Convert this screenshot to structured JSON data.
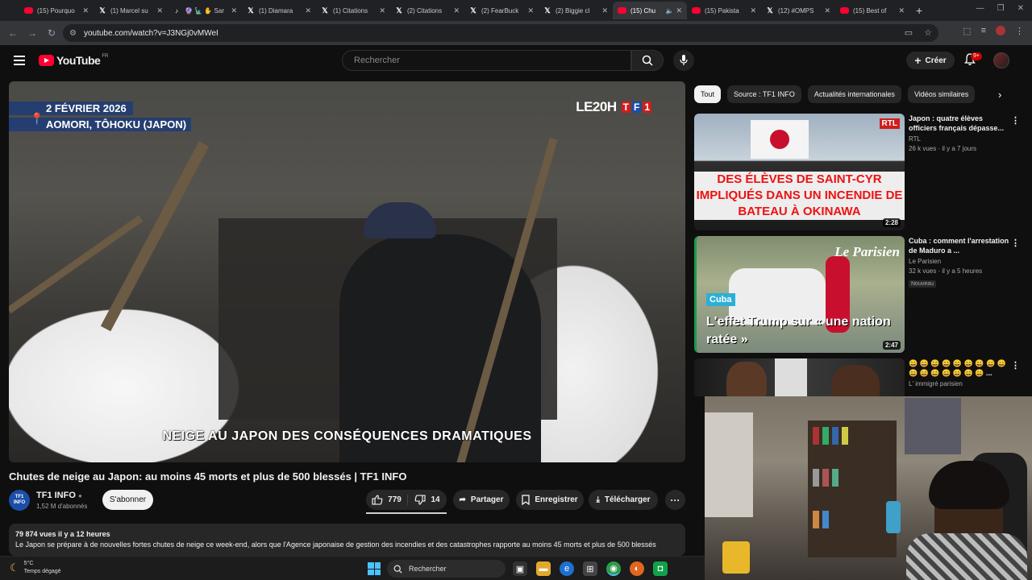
{
  "browser": {
    "tabs": [
      {
        "title": "(15) Pourquo",
        "icon": "youtube-icon"
      },
      {
        "title": "(1) Marcel su",
        "icon": "x-icon"
      },
      {
        "title": "🔮 🗽 ✋ Sar",
        "icon": "tiktok-icon"
      },
      {
        "title": "(1) Diamara",
        "icon": "x-icon"
      },
      {
        "title": "(1) Citations",
        "icon": "x-icon"
      },
      {
        "title": "(2) Citations",
        "icon": "x-icon"
      },
      {
        "title": "(2) FearBuck",
        "icon": "x-icon"
      },
      {
        "title": "(2) Biggie cl",
        "icon": "x-icon"
      },
      {
        "title": "(15) Chu",
        "icon": "youtube-icon",
        "active": true
      },
      {
        "title": "(15) Pakista",
        "icon": "youtube-icon"
      },
      {
        "title": "(12) #OMPS",
        "icon": "x-icon"
      },
      {
        "title": "(15) Best of",
        "icon": "youtube-icon"
      }
    ],
    "url": "youtube.com/watch?v=J3NGj0vMWeI"
  },
  "header": {
    "logo_text": "YouTube",
    "region": "FR",
    "search_placeholder": "Rechercher",
    "create_label": "Créer",
    "notif_count": "9+"
  },
  "player": {
    "date": "2 FÉVRIER 2026",
    "location": "AOMORI, TÔHOKU (JAPON)",
    "show_logo": "LE20H",
    "subtitle": "NEIGE AU JAPON  DES CONSÉQUENCES DRAMATIQUES"
  },
  "video": {
    "title": "Chutes de neige au Japon: au moins 45 morts et plus de 500 blessés | TF1 INFO",
    "channel": "TF1 INFO",
    "channel_avatar_text": "TF1 INFO",
    "subscribers": "1,52 M d'abonnés",
    "subscribe_label": "S'abonner",
    "likes": "779",
    "dislikes": "14",
    "share_label": "Partager",
    "save_label": "Enregistrer",
    "download_label": "Télécharger",
    "views_date": "79 874 vues  il y a 12 heures",
    "description": "Le Japon se prépare à de nouvelles fortes chutes de neige ce week-end, alors que l'Agence japonaise de gestion des incendies et des catastrophes rapporte au moins 45 morts et plus de 500 blessés"
  },
  "chips": [
    "Tout",
    "Source : TF1 INFO",
    "Actualités internationales",
    "Vidéos similaires"
  ],
  "recommendations": [
    {
      "title": "Japon : quatre élèves officiers français dépasse...",
      "channel": "RTL",
      "meta": "26 k vues · il y a 7 jours",
      "duration": "2:28",
      "thumb_brand": "RTL",
      "thumb_headline": "DES ÉLÈVES DE SAINT-CYR IMPLIQUÉS DANS UN INCENDIE DE BATEAU À OKINAWA"
    },
    {
      "title": "Cuba : comment l'arrestation de Maduro a ...",
      "channel": "Le Parisien",
      "meta": "32 k vues · il y a 5 heures",
      "badge": "Nouveau",
      "duration": "2:47",
      "thumb_brand": "Le Parisien",
      "thumb_tag": "Cuba",
      "thumb_quote": "L'effet Trump sur « une nation ratée »"
    },
    {
      "title": "😄 😄 😄 😄 😄 😄 😄 😄 😄 😄 😄 😄 😄 😄 😄 😄 ...",
      "channel": "L' immigré parisien",
      "meta": ""
    }
  ],
  "taskbar": {
    "temperature": "5°C",
    "weather": "Temps dégagé",
    "search_label": "Rechercher"
  },
  "colors": {
    "youtube_red": "#ff0033",
    "tf1_red": "#d01d1d",
    "tf1_blue": "#1a4ea8"
  }
}
